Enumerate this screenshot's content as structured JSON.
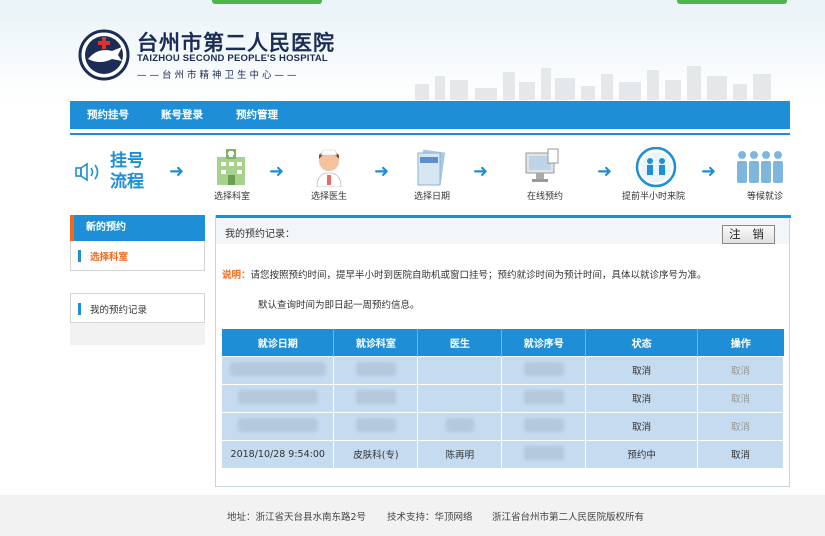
{
  "header": {
    "title_cn": "台州市第二人民医院",
    "title_en": "TAIZHOU SECOND PEOPLE'S HOSPITAL",
    "subtitle": "——台州市精神卫生中心——"
  },
  "nav": {
    "items": [
      "预约挂号",
      "账号登录",
      "预约管理"
    ]
  },
  "flow": {
    "title_line1": "挂号",
    "title_line2": "流程",
    "steps": [
      "选择科室",
      "选择医生",
      "选择日期",
      "在线预约",
      "提前半小时来院",
      "等候就诊"
    ]
  },
  "sidebar": {
    "head": "新的预约",
    "item1": "选择科室",
    "item2": "我的预约记录"
  },
  "main": {
    "records_title": "我的预约记录：",
    "logout": "注 销",
    "note_key": "说明：",
    "note_text": "请您按照预约时间，提早半小时到医院自助机或窗口挂号；预约就诊时间为预计时间，具体以就诊序号为准。",
    "note2": "默认查询时间为即日起一周预约信息。",
    "columns": [
      "就诊日期",
      "就诊科室",
      "医生",
      "就诊序号",
      "状态",
      "操作"
    ],
    "rows": [
      {
        "date": "",
        "dept": "",
        "doctor": "",
        "seq": "",
        "status": "取消",
        "action": "取消"
      },
      {
        "date": "",
        "dept": "",
        "doctor": "",
        "seq": "",
        "status": "取消",
        "action": "取消"
      },
      {
        "date": "",
        "dept": "",
        "doctor": "",
        "seq": "",
        "status": "取消",
        "action": "取消"
      },
      {
        "date": "2018/10/28 9:54:00",
        "dept": "皮肤科(专)",
        "doctor": "陈再明",
        "seq": "",
        "status": "预约中",
        "action": "取消"
      }
    ]
  },
  "footer": {
    "address": "地址：浙江省天台县水南东路2号",
    "support": "技术支持：华顶网络",
    "copyright": "浙江省台州市第二人民医院版权所有"
  },
  "colors": {
    "primary": "#1e8fd6",
    "accent": "#f26b1d",
    "table_cell": "#c5dbf0"
  }
}
